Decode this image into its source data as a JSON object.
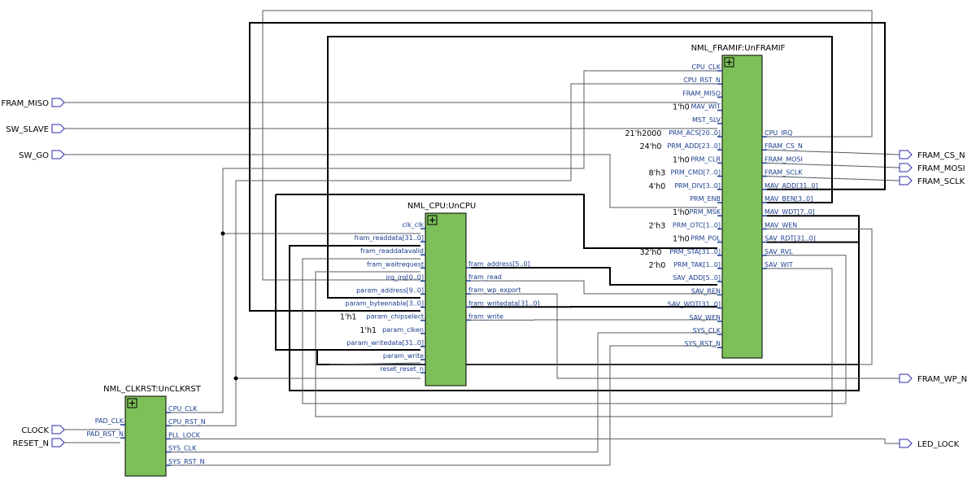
{
  "blocks": {
    "framif": {
      "title": "NML_FRAMIF:UnFRAMIF",
      "inputs": [
        {
          "pin": "CPU_CLK",
          "const": ""
        },
        {
          "pin": "CPU_RST_N",
          "const": ""
        },
        {
          "pin": "FRAM_MISO",
          "const": ""
        },
        {
          "pin": "MAV_WIT",
          "const": "1'h0"
        },
        {
          "pin": "MST_SLV",
          "const": ""
        },
        {
          "pin": "PRM_ACS[20..0]",
          "const": "21'h2000"
        },
        {
          "pin": "PRM_ADD[23..0]",
          "const": "24'h0"
        },
        {
          "pin": "PRM_CLR",
          "const": "1'h0"
        },
        {
          "pin": "PRM_CMD[7..0]",
          "const": "8'h3"
        },
        {
          "pin": "PRM_DIV[3..0]",
          "const": "4'h0"
        },
        {
          "pin": "PRM_ENB",
          "const": ""
        },
        {
          "pin": "PRM_MSK",
          "const": "1'h0"
        },
        {
          "pin": "PRM_OTC[1..0]",
          "const": "2'h3"
        },
        {
          "pin": "PRM_POL",
          "const": "1'h0"
        },
        {
          "pin": "PRM_STA[31..0]",
          "const": "32'h0"
        },
        {
          "pin": "PRM_TAK[1..0]",
          "const": "2'h0"
        },
        {
          "pin": "SAV_ADD[5..0]",
          "const": ""
        },
        {
          "pin": "SAV_REN",
          "const": ""
        },
        {
          "pin": "SAV_WDT[31..0]",
          "const": ""
        },
        {
          "pin": "SAV_WEN",
          "const": ""
        },
        {
          "pin": "SYS_CLK",
          "const": ""
        },
        {
          "pin": "SYS_RST_N",
          "const": ""
        }
      ],
      "outputs": [
        "CPU_IRQ",
        "FRAM_CS_N",
        "FRAM_MOSI",
        "FRAM_SCLK",
        "MAV_ADD[31..0]",
        "MAV_BEN[3..0]",
        "MAV_WDT[7..0]",
        "MAV_WEN",
        "SAV_RDT[31..0]",
        "SAV_RVL",
        "SAV_WIT"
      ]
    },
    "cpu": {
      "title": "NML_CPU:UnCPU",
      "inputs": [
        {
          "pin": "clk_clk",
          "const": ""
        },
        {
          "pin": "fram_readdata[31..0]",
          "const": ""
        },
        {
          "pin": "fram_readdatavalid",
          "const": ""
        },
        {
          "pin": "fram_waitrequest",
          "const": ""
        },
        {
          "pin": "irq_irq[0..0]",
          "const": ""
        },
        {
          "pin": "param_address[9..0]",
          "const": ""
        },
        {
          "pin": "param_byteenable[3..0]",
          "const": ""
        },
        {
          "pin": "param_chipselect",
          "const": "1'h1"
        },
        {
          "pin": "param_clken",
          "const": "1'h1"
        },
        {
          "pin": "param_writedata[31..0]",
          "const": ""
        },
        {
          "pin": "param_write",
          "const": ""
        },
        {
          "pin": "reset_reset_n",
          "const": ""
        }
      ],
      "outputs": [
        "fram_address[5..0]",
        "fram_read",
        "fram_wp_export",
        "fram_writedata[31..0]",
        "fram_write"
      ]
    },
    "clkrst": {
      "title": "NML_CLKRST:UnCLKRST",
      "inputs": [
        "PAD_CLK",
        "PAD_RST_N"
      ],
      "outputs": [
        "CPU_CLK",
        "CPU_RST_N",
        "PLL_LOCK",
        "SYS_CLK",
        "SYS_RST_N"
      ]
    }
  },
  "ports": {
    "inputs": [
      "FRAM_MISO",
      "SW_SLAVE",
      "SW_GO",
      "CLOCK",
      "RESET_N"
    ],
    "outputs": [
      "FRAM_CS_N",
      "FRAM_MOSI",
      "FRAM_SCLK",
      "FRAM_WP_N",
      "LED_LOCK"
    ]
  },
  "icons": {
    "expand": "expand-plus-icon",
    "input_port": "input-port-icon",
    "output_port": "output-port-icon"
  },
  "colors": {
    "block_fill": "#7dc05a",
    "pin_text": "#1a3d8f",
    "port_outline": "#2a2ab0",
    "wire": "#555a60",
    "bus": "#000000"
  }
}
